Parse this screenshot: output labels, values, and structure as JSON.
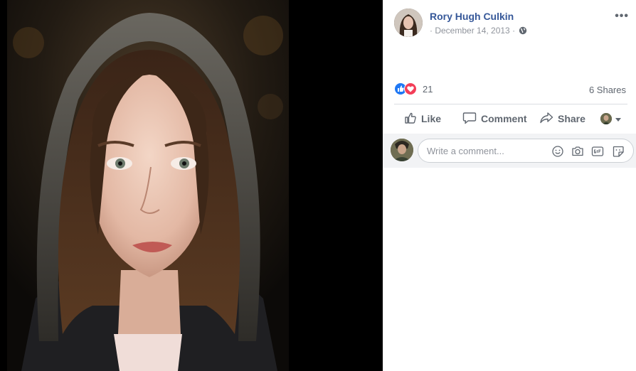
{
  "post": {
    "author": "Rory Hugh Culkin",
    "date": "· December 14, 2013 ·",
    "privacy_icon": "globe-icon",
    "more_label": "•••"
  },
  "reactions": {
    "icons": [
      "like-reaction-icon",
      "love-reaction-icon"
    ],
    "count": "21",
    "shares": "6 Shares"
  },
  "actions": {
    "like": "Like",
    "comment": "Comment",
    "share": "Share",
    "audience_icon": "chevron-down-icon"
  },
  "comment_box": {
    "placeholder": "Write a comment...",
    "icons": [
      "emoji-icon",
      "camera-icon",
      "gif-icon",
      "sticker-icon"
    ]
  },
  "colors": {
    "author_link": "#365899",
    "like_blue": "#2078f4",
    "love_red": "#f33e58"
  }
}
